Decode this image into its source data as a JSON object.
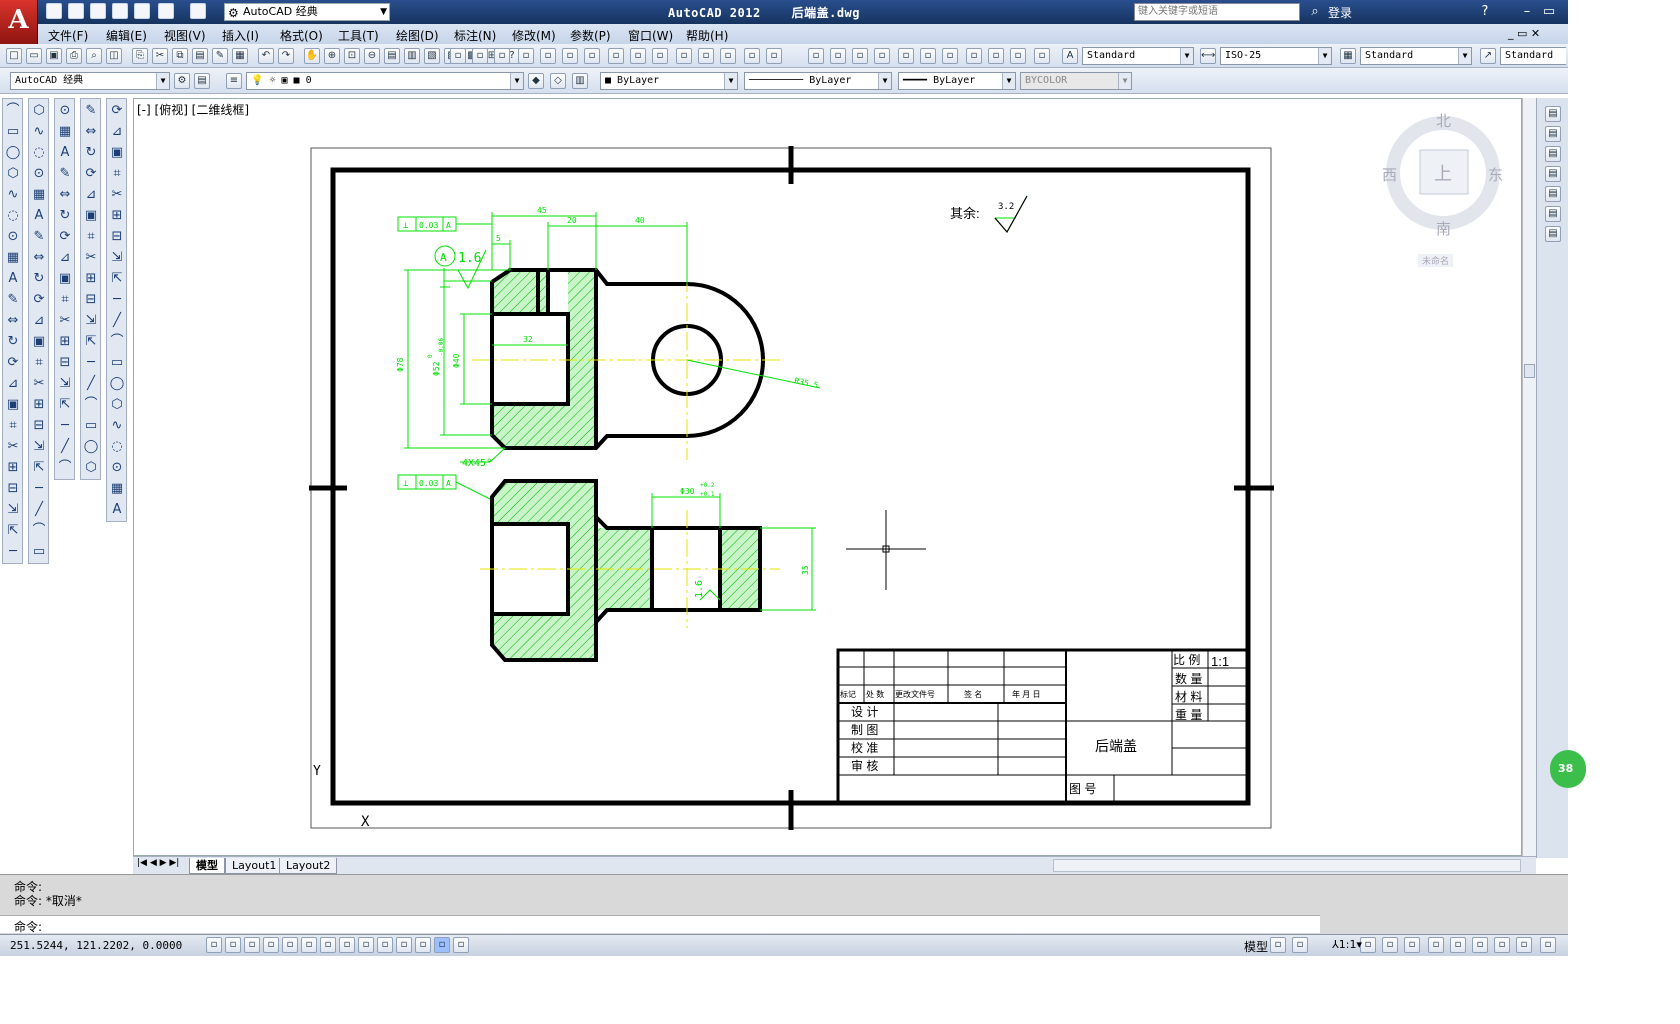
{
  "app": {
    "logo": "A",
    "title": "AutoCAD 2012",
    "filename": "后端盖.dwg",
    "workspace": "AutoCAD 经典",
    "search_placeholder": "键入关键字或短语",
    "login": "登录"
  },
  "menu": [
    "文件(F)",
    "编辑(E)",
    "视图(V)",
    "插入(I)",
    "格式(O)",
    "工具(T)",
    "绘图(D)",
    "标注(N)",
    "修改(M)",
    "参数(P)",
    "窗口(W)",
    "帮助(H)"
  ],
  "styles_toolbar": {
    "text_style": "Standard",
    "dim_style": "ISO-25",
    "table_style": "Standard",
    "multileader_style": "Standard"
  },
  "layers_toolbar": {
    "workspace": "AutoCAD 经典",
    "layer": "0",
    "color": "ByLayer",
    "linetype": "ByLayer",
    "lineweight": "ByLayer",
    "plotstyle": "BYCOLOR"
  },
  "viewport_label": "[-] [俯视] [二维线框]",
  "viewcube": {
    "north": "北",
    "south": "南",
    "east": "东",
    "west": "西",
    "top": "上",
    "wcs": "未命名"
  },
  "drawing": {
    "other_roughness_label": "其余:",
    "other_roughness_value": "3.2",
    "roughness_1": "1.6",
    "roughness_2": "1.6",
    "datum": "A",
    "tol_frame_1": [
      "⊥",
      "0.03",
      "A"
    ],
    "tol_frame_2": [
      "⊥",
      "0.03",
      "A"
    ],
    "dims": {
      "d45": "45",
      "d20": "20",
      "d40": "40",
      "d5": "5",
      "d32": "32",
      "dia78": "Φ78",
      "dia52": "Φ52",
      "dia52_tol_up": "0",
      "dia52_tol_dn": "-0.06",
      "dia40": "Φ40",
      "r35": "R35.5",
      "chamfer": "4X45°",
      "dia30": "Φ30",
      "dia30_tol_up": "+0.2",
      "dia30_tol_dn": "+0.1",
      "d35": "35"
    },
    "ucs_y": "Y",
    "ucs_x": "X"
  },
  "titleblock": {
    "header_cells": [
      "标记",
      "处 数",
      "更改文件号",
      "签 名",
      "年 月 日"
    ],
    "rows": [
      "设 计",
      "制 图",
      "校 准",
      "审 核"
    ],
    "part_name": "后端盖",
    "drawing_no_label": "图 号",
    "ratio_label": "比 例",
    "ratio_value": "1:1",
    "qty_label": "数 量",
    "material_label": "材 料",
    "weight_label": "重 量"
  },
  "tabs": [
    "模型",
    "Layout1",
    "Layout2"
  ],
  "command": {
    "line1": "命令:",
    "line2": "命令: *取消*",
    "prompt": "命令:"
  },
  "status": {
    "coords": "251.5244, 121.2202, 0.0000",
    "model": "模型",
    "scale": "1:1",
    "badge": "38"
  },
  "colors": {
    "hatch": "#00c000",
    "dim": "#00ff00",
    "center": "#e6e600",
    "frame": "#000000"
  }
}
